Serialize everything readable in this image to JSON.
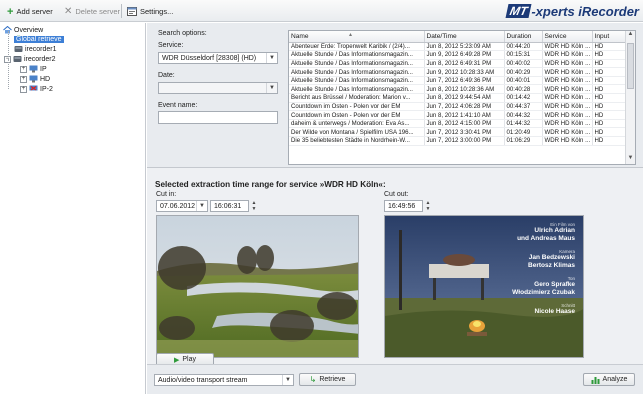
{
  "toolbar": {
    "add_server": "Add server",
    "delete_server": "Delete server",
    "settings": "Settings..."
  },
  "brand": {
    "logo_prefix": "MT",
    "logo_suffix": "-xperts iRecorder"
  },
  "tree": {
    "overview": "Overview",
    "global_retrieve": "Global retrieve",
    "irecorder1": "irecorder1",
    "irecorder2": "irecorder2",
    "ip": "IP",
    "hd": "HD",
    "ip2": "IP-2"
  },
  "search": {
    "options_label": "Search options:",
    "service_label": "Service:",
    "service_value": "WDR Düsseldorf [28308] (HD)",
    "date_label": "Date:",
    "date_value": "",
    "event_label": "Event name:",
    "event_value": ""
  },
  "table": {
    "columns": [
      "Name",
      "Date/Time",
      "Duration",
      "Service",
      "Input"
    ],
    "rows": [
      [
        "Abenteuer Erde: Tropenwelt Karibik / (2/4)...",
        "Jun 8, 2012 5:23:09 AM",
        "00:44:20",
        "WDR HD Köln ...",
        "HD"
      ],
      [
        "Aktuelle Stunde / Das Informationsmagazin...",
        "Jun 9, 2012 6:49:28 PM",
        "00:15:31",
        "WDR HD Köln ...",
        "HD"
      ],
      [
        "Aktuelle Stunde / Das Informationsmagazin...",
        "Jun 8, 2012 6:49:31 PM",
        "00:40:02",
        "WDR HD Köln ...",
        "HD"
      ],
      [
        "Aktuelle Stunde / Das Informationsmagazin...",
        "Jun 9, 2012 10:28:33 AM",
        "00:40:29",
        "WDR HD Köln ...",
        "HD"
      ],
      [
        "Aktuelle Stunde / Das Informationsmagazin...",
        "Jun 7, 2012 6:49:36 PM",
        "00:40:01",
        "WDR HD Köln ...",
        "HD"
      ],
      [
        "Aktuelle Stunde / Das Informationsmagazin...",
        "Jun 8, 2012 10:28:36 AM",
        "00:40:28",
        "WDR HD Köln ...",
        "HD"
      ],
      [
        "Bericht aus Brüssel / Moderation: Marion v...",
        "Jun 8, 2012 9:44:54 AM",
        "00:14:42",
        "WDR HD Köln ...",
        "HD"
      ],
      [
        "Countdown im Osten - Polen vor der EM",
        "Jun 7, 2012 4:06:28 PM",
        "00:44:37",
        "WDR HD Köln ...",
        "HD"
      ],
      [
        "Countdown im Osten - Polen vor der EM",
        "Jun 8, 2012 1:41:10 AM",
        "00:44:32",
        "WDR HD Köln ...",
        "HD"
      ],
      [
        "daheim & unterwegs / Moderation: Eva As...",
        "Jun 8, 2012 4:15:00 PM",
        "01:44:32",
        "WDR HD Köln ...",
        "HD"
      ],
      [
        "Der Wilde von Montana / Spielfilm USA 196...",
        "Jun 7, 2012 3:30:41 PM",
        "01:20:49",
        "WDR HD Köln ...",
        "HD"
      ],
      [
        "Die 35 beliebtesten Städte in Nordrhein-W...",
        "Jun 7, 2012 3:00:00 PM",
        "01:06:29",
        "WDR HD Köln ...",
        "HD"
      ]
    ]
  },
  "extraction": {
    "title": "Selected extraction time range for service »WDR HD Köln«:",
    "cut_in_label": "Cut in:",
    "cut_in_date": "07.06.2012",
    "cut_in_time": "16:06:31",
    "cut_out_label": "Cut out:",
    "cut_out_time": "16:49:56"
  },
  "credits": [
    "Ein Film von",
    "Ulrich Adrian",
    "und Andreas Maus",
    "Kamera",
    "Jan Bedzewski",
    "Bertosz Klimas",
    "Ton",
    "Gero Sprafke",
    "Włodzimierz Czubak",
    "Schnitt",
    "Nicole Haase"
  ],
  "controls": {
    "play_label": "Play",
    "stream_type": "Audio/video transport stream",
    "retrieve_label": "Retrieve",
    "analyze_label": "Analyze"
  },
  "colors": {
    "selection": "#3d7fd6",
    "brand": "#1c3a78",
    "play_icon": "#2e9a3a"
  }
}
